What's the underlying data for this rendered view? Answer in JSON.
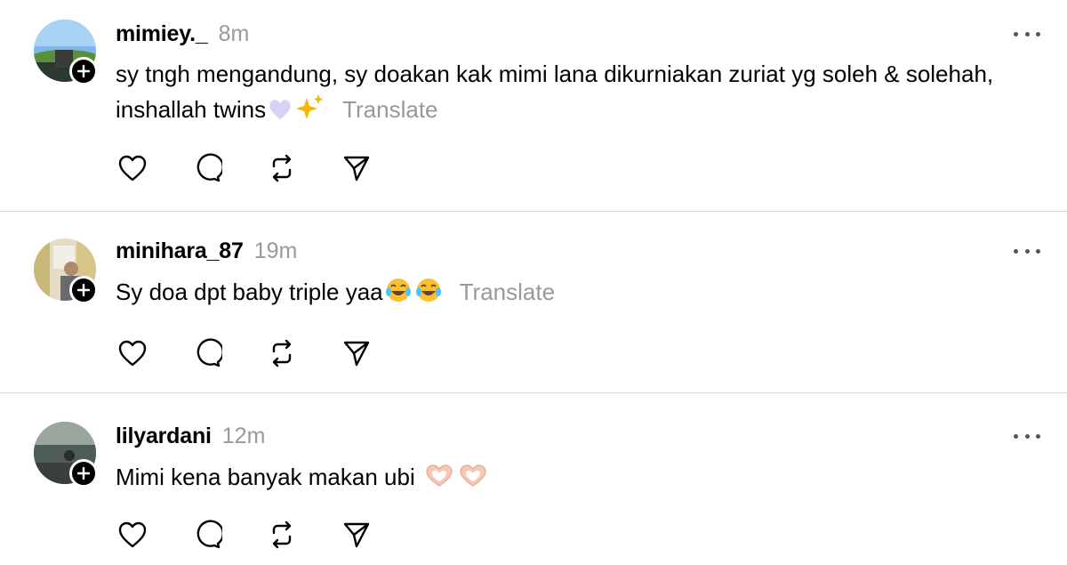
{
  "posts": [
    {
      "username": "mimiey._",
      "timestamp": "8m",
      "text": "sy tngh mengandung, sy doakan kak mimi lana dikurniakan zuriat yg soleh & solehah, inshallah twins",
      "emojis": [
        "purple-heart",
        "sparkles"
      ],
      "translate_label": "Translate"
    },
    {
      "username": "minihara_87",
      "timestamp": "19m",
      "text": "Sy doa dpt baby triple yaa",
      "emojis": [
        "tears-of-joy",
        "tears-of-joy"
      ],
      "translate_label": "Translate"
    },
    {
      "username": "lilyardani",
      "timestamp": "12m",
      "text": "Mimi kena banyak makan ubi",
      "emojis": [
        "heart-hands",
        "heart-hands"
      ],
      "translate_label": ""
    }
  ],
  "actions": [
    "heart-icon",
    "comment-icon",
    "repost-icon",
    "share-icon"
  ],
  "colors": {
    "text": "#000000",
    "muted": "#999999",
    "divider": "#d9d9d9",
    "icon": "#000000"
  }
}
